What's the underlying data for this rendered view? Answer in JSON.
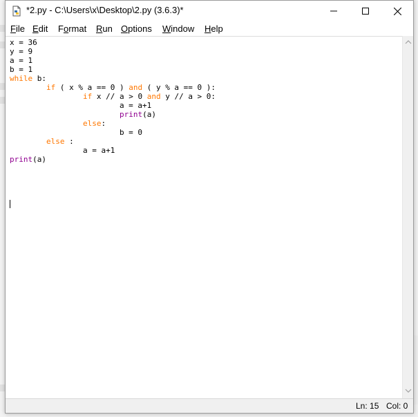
{
  "window": {
    "title": "*2.py - C:\\Users\\x\\Desktop\\2.py (3.6.3)*",
    "icon": "python-file-icon",
    "controls": {
      "minimize": "minimize-icon",
      "maximize": "maximize-icon",
      "close": "close-icon"
    }
  },
  "menu": {
    "file": {
      "mnemonic": "F",
      "rest": "ile"
    },
    "edit": {
      "mnemonic": "E",
      "rest": "dit"
    },
    "format": {
      "pre": "F",
      "mnemonic": "o",
      "rest": "rmat"
    },
    "run": {
      "mnemonic": "R",
      "rest": "un"
    },
    "options": {
      "mnemonic": "O",
      "rest": "ptions"
    },
    "window": {
      "mnemonic": "W",
      "rest": "indow"
    },
    "help": {
      "mnemonic": "H",
      "rest": "elp"
    }
  },
  "code": {
    "lines": [
      {
        "pre": "x = 36"
      },
      {
        "pre": "y = 9"
      },
      {
        "pre": "a = 1"
      },
      {
        "pre": "b = 1"
      },
      {
        "kw": "while",
        "post": " b:"
      },
      {
        "pre": "        ",
        "kw": "if",
        "mid": " ( x % a == 0 ) ",
        "kw2": "and",
        "post": " ( y % a == 0 ):"
      },
      {
        "pre": "                ",
        "kw": "if",
        "mid": " x // a > 0 ",
        "kw2": "and",
        "post": " y // a > 0:"
      },
      {
        "pre": "                        a = a+1"
      },
      {
        "pre": "                        ",
        "bi": "print",
        "post": "(a)"
      },
      {
        "pre": "                ",
        "kw": "else",
        "post": ":"
      },
      {
        "pre": "                        b = 0"
      },
      {
        "pre": "        ",
        "kw": "else",
        "post": " :"
      },
      {
        "pre": "                a = a+1"
      },
      {
        "bi": "print",
        "post": "(a)"
      }
    ]
  },
  "colors": {
    "keyword": "#ff7700",
    "builtin": "#900090",
    "text": "#000000"
  },
  "status": {
    "line": "Ln: 15",
    "column": "Col: 0"
  }
}
